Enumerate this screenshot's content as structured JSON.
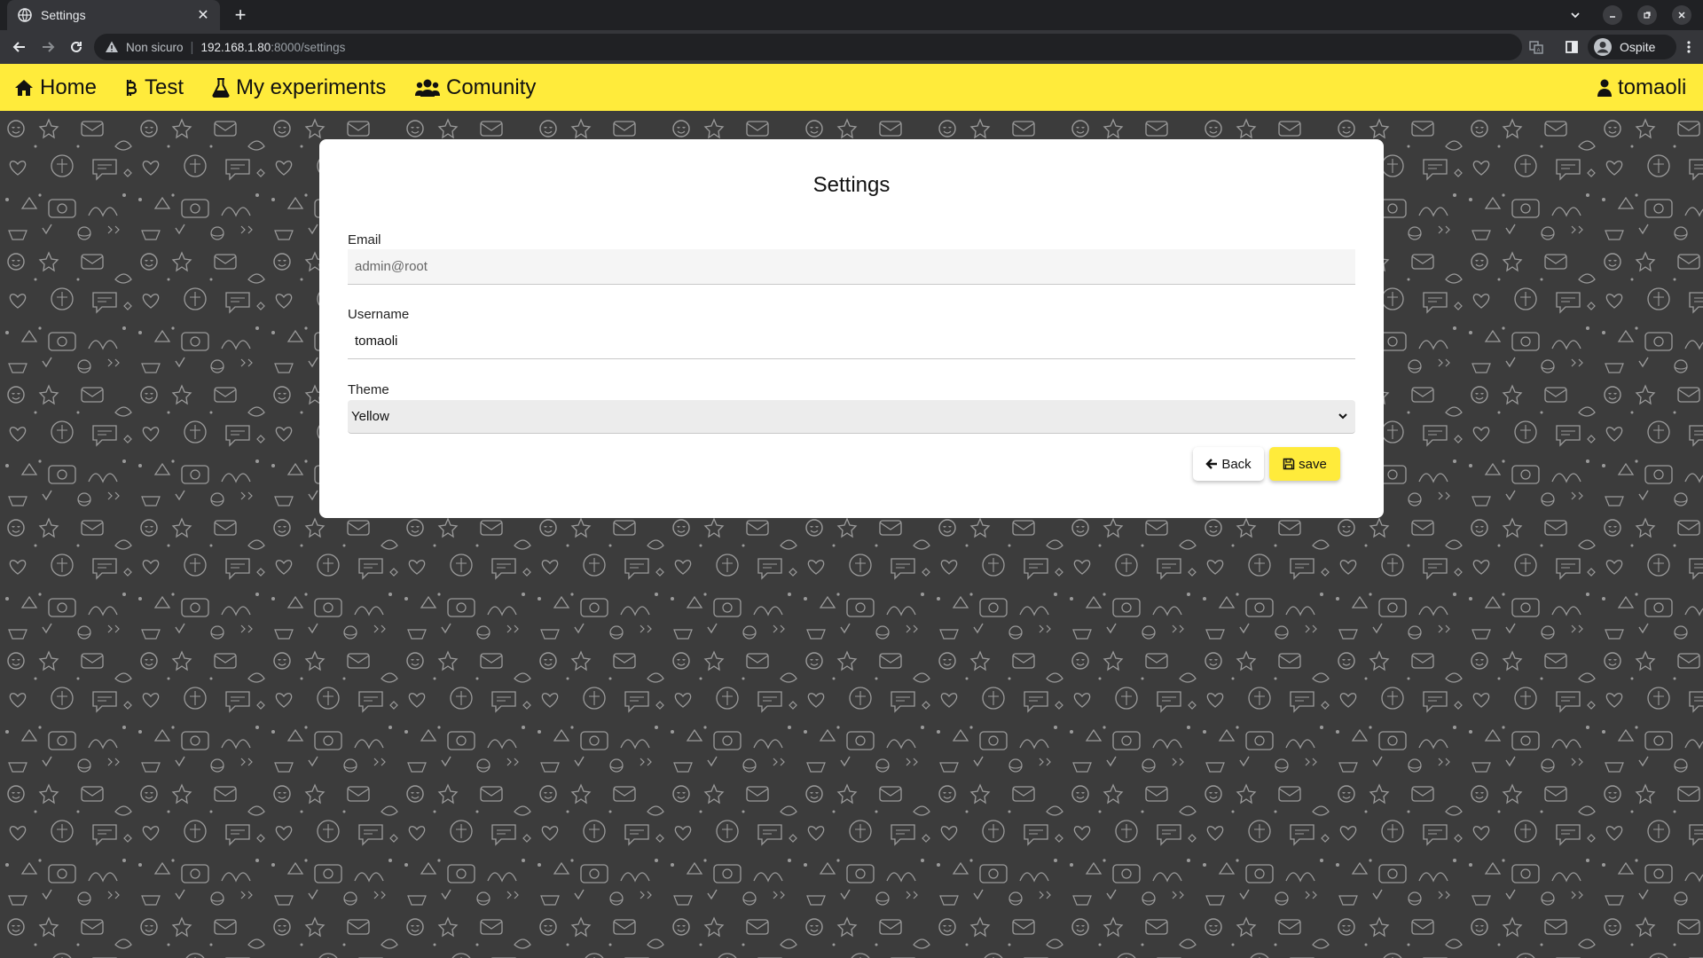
{
  "browser": {
    "tab_title": "Settings",
    "insecure_label": "Non sicuro",
    "url_host": "192.168.1.80",
    "url_path": ":8000/settings",
    "profile_label": "Ospite"
  },
  "navbar": {
    "home": "Home",
    "test": "Test",
    "experiments": "My experiments",
    "community": "Comunity",
    "user": "tomaoli",
    "color": "#ffeb3b"
  },
  "settings": {
    "title": "Settings",
    "email_label": "Email",
    "email_value": "admin@root",
    "username_label": "Username",
    "username_value": "tomaoli",
    "theme_label": "Theme",
    "theme_value": "Yellow",
    "back_label": "Back",
    "save_label": "save"
  }
}
